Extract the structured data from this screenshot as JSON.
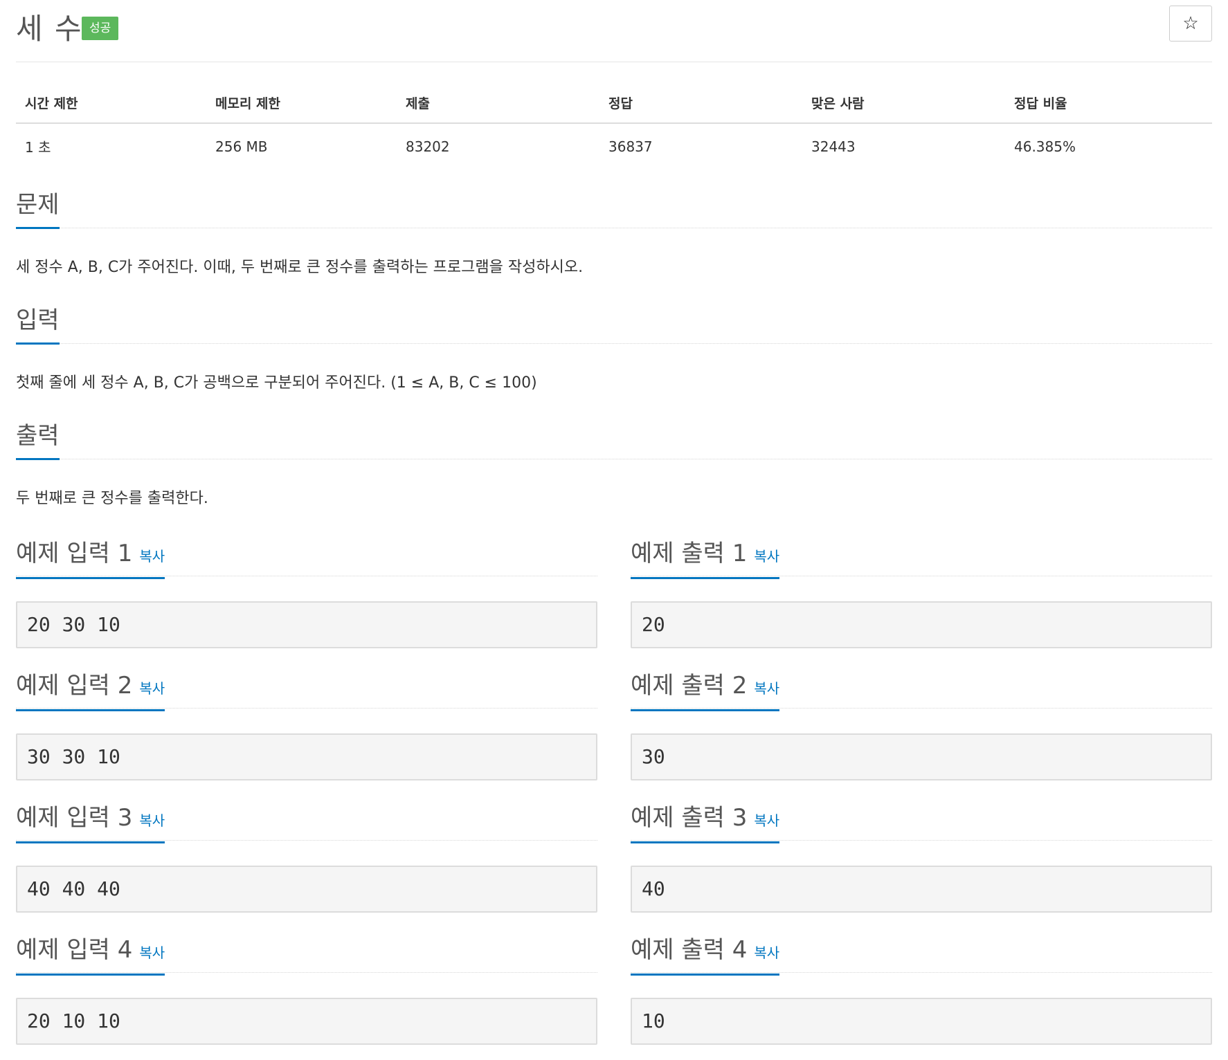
{
  "problem": {
    "title": "세 수",
    "badge": "성공",
    "favorite_icon": "star-outline-icon"
  },
  "stats": {
    "headers": [
      "시간 제한",
      "메모리 제한",
      "제출",
      "정답",
      "맞은 사람",
      "정답 비율"
    ],
    "values": [
      "1 초",
      "256 MB",
      "83202",
      "36837",
      "32443",
      "46.385%"
    ]
  },
  "sections": {
    "description": {
      "heading": "문제",
      "text": "세 정수 A, B, C가 주어진다. 이때, 두 번째로 큰 정수를 출력하는 프로그램을 작성하시오."
    },
    "input": {
      "heading": "입력",
      "text": "첫째 줄에 세 정수 A, B, C가 공백으로 구분되어 주어진다. (1 ≤ A, B, C ≤ 100)"
    },
    "output": {
      "heading": "출력",
      "text": "두 번째로 큰 정수를 출력한다."
    }
  },
  "copy_label": "복사",
  "samples": [
    {
      "input_title": "예제 입력 1",
      "input": "20 30 10",
      "output_title": "예제 출력 1",
      "output": "20"
    },
    {
      "input_title": "예제 입력 2",
      "input": "30 30 10",
      "output_title": "예제 출력 2",
      "output": "30"
    },
    {
      "input_title": "예제 입력 3",
      "input": "40 40 40",
      "output_title": "예제 출력 3",
      "output": "40"
    },
    {
      "input_title": "예제 입력 4",
      "input": "20 10 10",
      "output_title": "예제 출력 4",
      "output": "10"
    }
  ]
}
